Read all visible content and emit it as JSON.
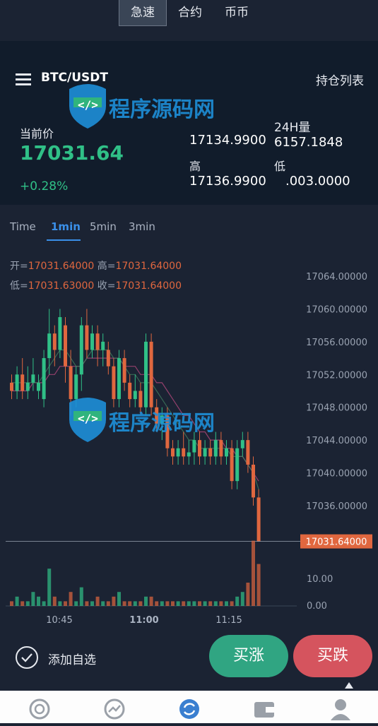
{
  "tabs": [
    {
      "label": "急速",
      "active": true
    },
    {
      "label": "合约",
      "active": false
    },
    {
      "label": "币币",
      "active": false
    }
  ],
  "header": {
    "pair": "BTC/USDT",
    "positions_label": "持仓列表"
  },
  "stats": {
    "current_label": "当前价",
    "current_price": "17031.64",
    "change": "+0.28%",
    "low_value": "17134.9900",
    "volume_label": "24H量",
    "volume_value": "6157.1848",
    "high_label": "高",
    "high_value": "17136.9900",
    "low_label": "低",
    "low_value2": ".003.0000"
  },
  "timeframes": [
    {
      "label": "Time",
      "active": false
    },
    {
      "label": "1min",
      "active": true
    },
    {
      "label": "5min",
      "active": false
    },
    {
      "label": "3min",
      "active": false
    }
  ],
  "ohlc": {
    "open_label": "开=",
    "open": "17031.64000",
    "high_label": "高=",
    "high": "17031.64000",
    "low_label": "低=",
    "low": "17031.63000",
    "close_label": "收=",
    "close": "17031.64000"
  },
  "colors": {
    "up": "#30c087",
    "down": "#e0673f",
    "bg": "#1b2333",
    "panel": "#111c2b",
    "accent": "#3a8fe8"
  },
  "chart_data": {
    "type": "candlestick",
    "y_ticks": [
      17064,
      17060,
      17056,
      17052,
      17048,
      17044,
      17040,
      17036
    ],
    "y_tick_labels": [
      "17064.00000",
      "17060.00000",
      "17056.00000",
      "17052.00000",
      "17048.00000",
      "17044.00000",
      "17040.00000",
      "17036.00000"
    ],
    "ylim": [
      17029.5,
      17066
    ],
    "x_ticks": [
      "10:45",
      "11:00",
      "11:15"
    ],
    "last_price": 17031.64,
    "last_price_label": "17031.64000",
    "volume_ticks": [
      "10.00",
      "0.00"
    ],
    "candles": [
      {
        "o": 17051,
        "c": 17050,
        "h": 17052,
        "l": 17049
      },
      {
        "o": 17050,
        "c": 17052,
        "h": 17053,
        "l": 17049
      },
      {
        "o": 17052,
        "c": 17050,
        "h": 17054,
        "l": 17049
      },
      {
        "o": 17050,
        "c": 17051,
        "h": 17053,
        "l": 17049
      },
      {
        "o": 17051,
        "c": 17052,
        "h": 17054,
        "l": 17050
      },
      {
        "o": 17050,
        "c": 17051,
        "h": 17052,
        "l": 17049
      },
      {
        "o": 17049,
        "c": 17054,
        "h": 17055,
        "l": 17048
      },
      {
        "o": 17054,
        "c": 17057,
        "h": 17060,
        "l": 17052
      },
      {
        "o": 17057,
        "c": 17055,
        "h": 17058,
        "l": 17053
      },
      {
        "o": 17055,
        "c": 17059,
        "h": 17060,
        "l": 17054
      },
      {
        "o": 17058,
        "c": 17053,
        "h": 17059,
        "l": 17051
      },
      {
        "o": 17053,
        "c": 17049,
        "h": 17055,
        "l": 17047
      },
      {
        "o": 17049,
        "c": 17052,
        "h": 17053,
        "l": 17048
      },
      {
        "o": 17052,
        "c": 17058,
        "h": 17059,
        "l": 17050
      },
      {
        "o": 17058,
        "c": 17055,
        "h": 17060,
        "l": 17054
      },
      {
        "o": 17055,
        "c": 17057,
        "h": 17058,
        "l": 17054
      },
      {
        "o": 17057,
        "c": 17055,
        "h": 17058,
        "l": 17053
      },
      {
        "o": 17055,
        "c": 17056,
        "h": 17057,
        "l": 17053
      },
      {
        "o": 17055,
        "c": 17053,
        "h": 17056,
        "l": 17052
      },
      {
        "o": 17053,
        "c": 17049,
        "h": 17054,
        "l": 17048
      },
      {
        "o": 17049,
        "c": 17054,
        "h": 17055,
        "l": 17048
      },
      {
        "o": 17054,
        "c": 17051,
        "h": 17055,
        "l": 17050
      },
      {
        "o": 17051,
        "c": 17049,
        "h": 17052,
        "l": 17048
      },
      {
        "o": 17049,
        "c": 17050,
        "h": 17052,
        "l": 17048
      },
      {
        "o": 17050,
        "c": 17048,
        "h": 17051,
        "l": 17047
      },
      {
        "o": 17048,
        "c": 17056,
        "h": 17057,
        "l": 17047
      },
      {
        "o": 17056,
        "c": 17048,
        "h": 17057,
        "l": 17047
      },
      {
        "o": 17048,
        "c": 17046,
        "h": 17049,
        "l": 17045
      },
      {
        "o": 17046,
        "c": 17047,
        "h": 17048,
        "l": 17044
      },
      {
        "o": 17047,
        "c": 17043,
        "h": 17048,
        "l": 17042
      },
      {
        "o": 17043,
        "c": 17042,
        "h": 17044,
        "l": 17041
      },
      {
        "o": 17042,
        "c": 17043,
        "h": 17044,
        "l": 17041
      },
      {
        "o": 17043,
        "c": 17042,
        "h": 17045,
        "l": 17041
      },
      {
        "o": 17042,
        "c": 17042.5,
        "h": 17044,
        "l": 17041
      },
      {
        "o": 17042.5,
        "c": 17044,
        "h": 17045,
        "l": 17041
      },
      {
        "o": 17044,
        "c": 17042,
        "h": 17045,
        "l": 17041
      },
      {
        "o": 17042,
        "c": 17043,
        "h": 17044,
        "l": 17041
      },
      {
        "o": 17043,
        "c": 17042,
        "h": 17044,
        "l": 17041
      },
      {
        "o": 17042,
        "c": 17044,
        "h": 17045,
        "l": 17041
      },
      {
        "o": 17044,
        "c": 17042,
        "h": 17045,
        "l": 17041
      },
      {
        "o": 17042,
        "c": 17043,
        "h": 17044,
        "l": 17041
      },
      {
        "o": 17043,
        "c": 17039,
        "h": 17044,
        "l": 17038
      },
      {
        "o": 17039,
        "c": 17043,
        "h": 17044,
        "l": 17038
      },
      {
        "o": 17043,
        "c": 17044,
        "h": 17045,
        "l": 17042
      },
      {
        "o": 17044,
        "c": 17041,
        "h": 17045,
        "l": 17040
      },
      {
        "o": 17041,
        "c": 17037,
        "h": 17042,
        "l": 17036
      },
      {
        "o": 17037,
        "c": 17031.64,
        "h": 17038,
        "l": 17031.6
      }
    ],
    "volumes": [
      1,
      2,
      1,
      1,
      3,
      2,
      1,
      8,
      2,
      1,
      1,
      3,
      1,
      4,
      1,
      1,
      2,
      1,
      1,
      2,
      3,
      1,
      1,
      1,
      1,
      2,
      2,
      1,
      1,
      1,
      1,
      1,
      1,
      1,
      1,
      1,
      1,
      1,
      1,
      1,
      1,
      1,
      2,
      3,
      5,
      14,
      9
    ],
    "ma_fast": [
      17051,
      17051,
      17051,
      17051,
      17051,
      17051,
      17052,
      17053,
      17054,
      17055,
      17055,
      17054,
      17053,
      17053,
      17054,
      17055,
      17055,
      17055,
      17055,
      17054,
      17054,
      17053,
      17052,
      17052,
      17051,
      17051,
      17051,
      17050,
      17049,
      17048,
      17047,
      17046,
      17045,
      17044,
      17044,
      17043,
      17043,
      17043,
      17043,
      17043,
      17043,
      17042,
      17042,
      17042,
      17041,
      17040,
      17038
    ],
    "ma_slow": [
      17050,
      17050,
      17050,
      17050,
      17051,
      17051,
      17051,
      17052,
      17052,
      17053,
      17053,
      17053,
      17053,
      17053,
      17054,
      17054,
      17054,
      17054,
      17054,
      17054,
      17054,
      17053,
      17053,
      17053,
      17052,
      17052,
      17052,
      17051,
      17051,
      17050,
      17049,
      17048,
      17047,
      17047,
      17046,
      17045,
      17045,
      17044,
      17044,
      17044,
      17043,
      17043,
      17042,
      17042,
      17041,
      17040,
      17039
    ]
  },
  "footer": {
    "favorite_label": "添加自选",
    "buy_label": "买涨",
    "sell_label": "买跌"
  },
  "nav": [
    {
      "icon": "market-icon"
    },
    {
      "icon": "trend-icon"
    },
    {
      "icon": "trade-icon"
    },
    {
      "icon": "wallet-icon"
    },
    {
      "icon": "profile-icon"
    }
  ],
  "watermark": {
    "text": "程序源码网"
  }
}
